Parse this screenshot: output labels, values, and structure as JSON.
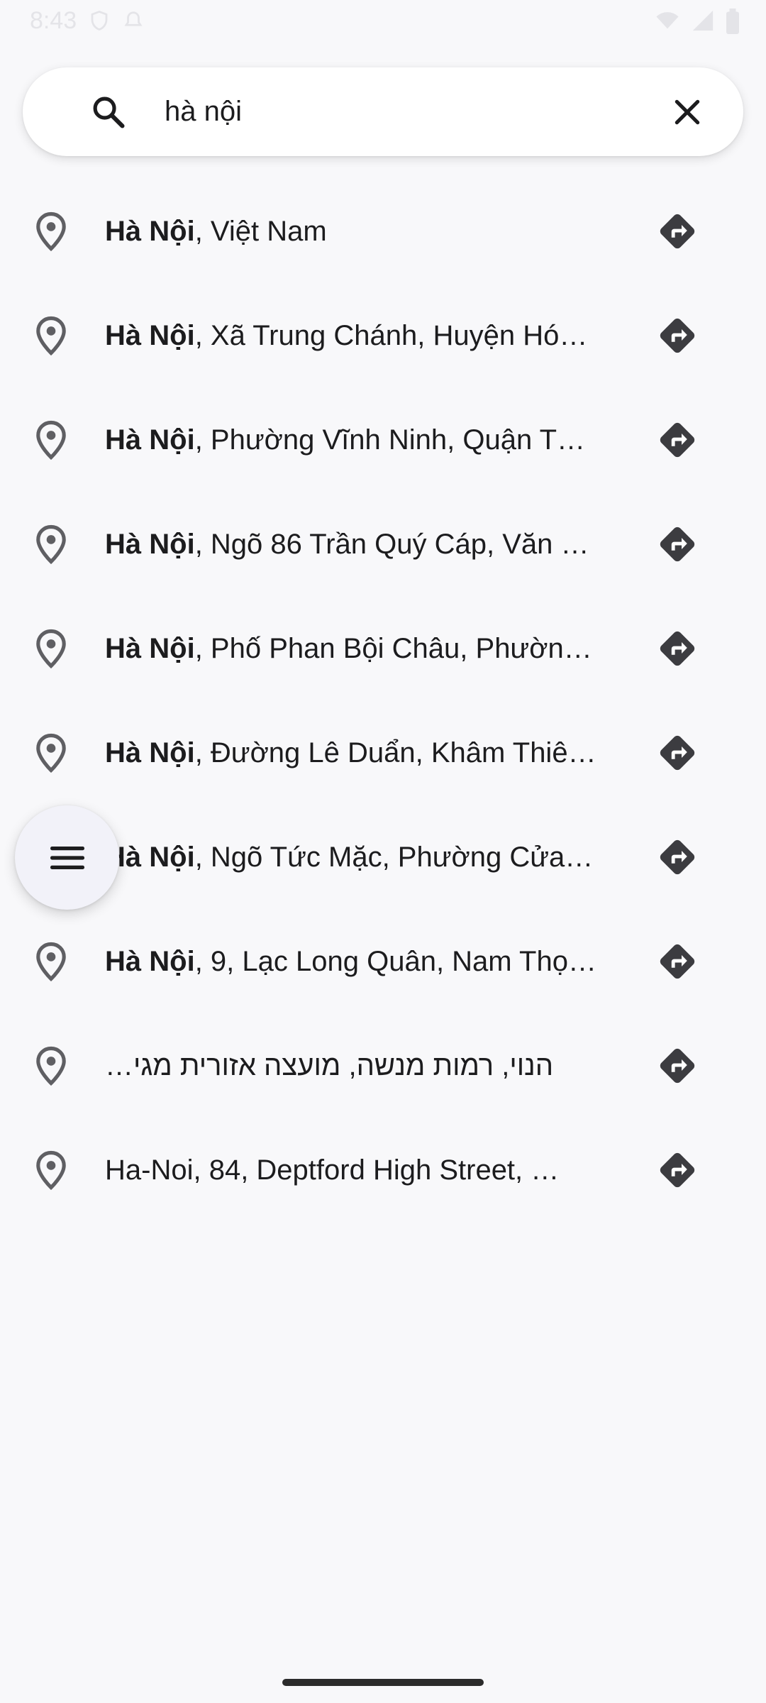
{
  "status_bar": {
    "time": "8:43",
    "icons": [
      "shield-icon",
      "notification-icon",
      "wifi-icon",
      "signal-icon",
      "battery-icon"
    ]
  },
  "search": {
    "value": "hà nội",
    "icon": "search-icon",
    "clear_icon": "close-icon"
  },
  "results": [
    {
      "bold": "Hà Nội",
      "rest": ", Việt Nam"
    },
    {
      "bold": "Hà Nội",
      "rest": ", Xã Trung Chánh, Huyện Hóc…"
    },
    {
      "bold": "Hà Nội",
      "rest": ", Phường Vĩnh Ninh, Quận Th…"
    },
    {
      "bold": "Hà Nội",
      "rest": ", Ngõ 86 Trần Quý Cáp, Văn …"
    },
    {
      "bold": "Hà Nội",
      "rest": ", Phố Phan Bội Châu, Phường…"
    },
    {
      "bold": "Hà Nội",
      "rest": ", Đường Lê Duẩn, Khâm Thiê…"
    },
    {
      "bold": "Hà Nội",
      "rest": ", Ngõ Tức Mặc, Phường Cửa …"
    },
    {
      "bold": "Hà Nội",
      "rest": ", 9, Lạc Long Quân, Nam Thọ,…"
    },
    {
      "bold": "",
      "rest": "…הנוי, רמות מנשה, מועצה אזורית מגי"
    },
    {
      "bold": "",
      "rest": "Ha-Noi, 84, Deptford High Street, …"
    }
  ],
  "fab": {
    "icon": "menu-icon"
  },
  "colors": {
    "background": "#f8f8fa",
    "icon_gray": "#5f5f63",
    "directions_icon": "#3c3c40"
  }
}
